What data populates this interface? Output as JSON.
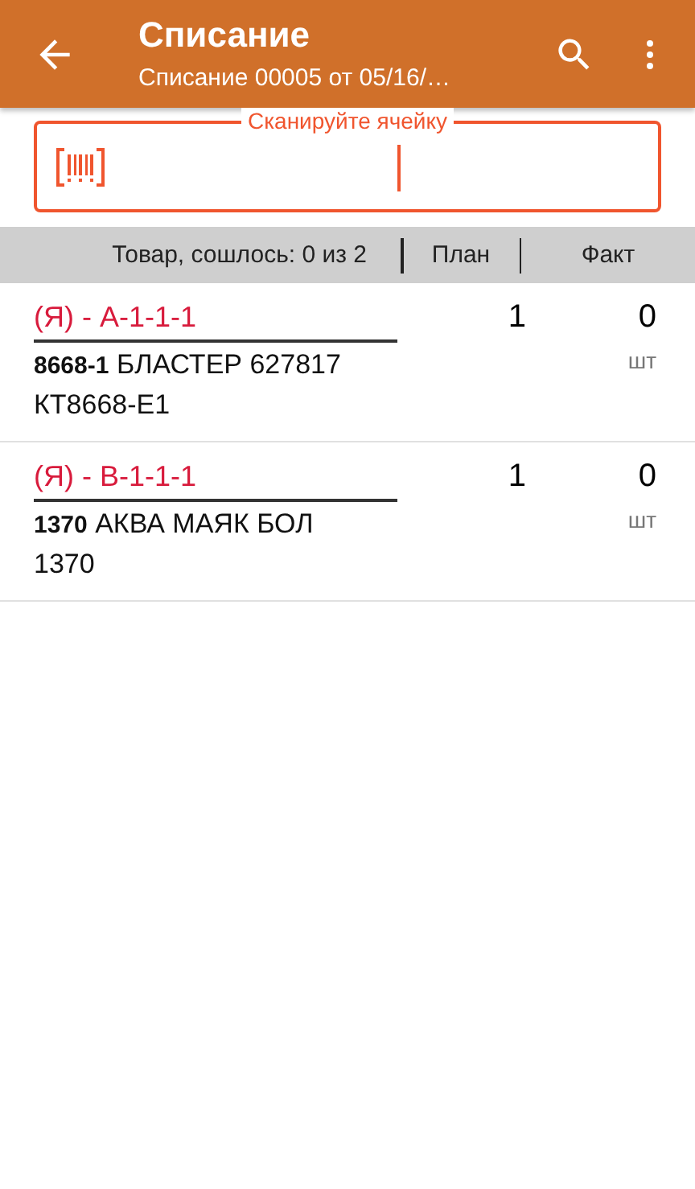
{
  "app_bar": {
    "title": "Списание",
    "subtitle": "Списание 00005 от 05/16/…"
  },
  "scan_field": {
    "label": "Сканируйте ячейку"
  },
  "table": {
    "columns": [
      "Товар, сошлось: 0 из 2",
      "План",
      "Факт"
    ],
    "rows": [
      {
        "cell": "(Я) - А-1-1-1",
        "item": "**8668-1** БЛАСТЕР 627817 КТ8668-Е1",
        "plan": "1",
        "fact": "0",
        "unit": "шт"
      },
      {
        "cell": "(Я) - В-1-1-1",
        "item": "**1370** АКВА МАЯК БОЛ 1370",
        "plan": "1",
        "fact": "0",
        "unit": "шт"
      }
    ]
  }
}
